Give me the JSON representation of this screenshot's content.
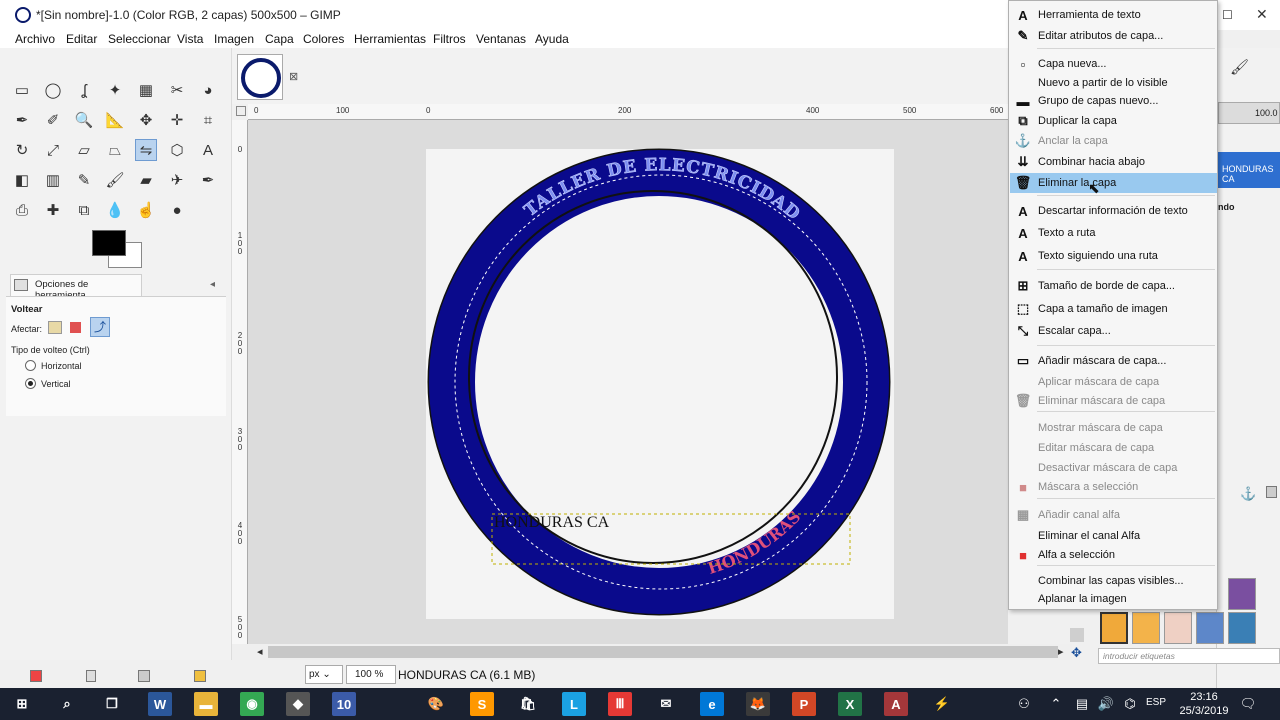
{
  "window": {
    "title": "*[Sin nombre]-1.0 (Color RGB, 2 capas) 500x500 – GIMP",
    "minimize": "–",
    "maximize": "☐",
    "close": "✕"
  },
  "menubar": [
    "Archivo",
    "Editar",
    "Seleccionar",
    "Vista",
    "Imagen",
    "Capa",
    "Colores",
    "Herramientas",
    "Filtros",
    "Ventanas",
    "Ayuda"
  ],
  "tool_options": {
    "tab_label": "Opciones de herramienta",
    "tool_name": "Voltear",
    "affect_label": "Afectar:",
    "flip_type_label": "Tipo de volteo  (Ctrl)",
    "horizontal": "Horizontal",
    "vertical": "Vertical",
    "selected": "Vertical"
  },
  "rulers": {
    "horizontal": [
      "0",
      "100",
      "0",
      "200",
      "400",
      "500",
      "600"
    ],
    "vertical": [
      "0",
      "100",
      "200",
      "300",
      "400",
      "500"
    ]
  },
  "canvas": {
    "top_text": "TALLER DE ELECTRICIDAD",
    "bottom_text": "HONDURAS CA",
    "plain_text": "HONDURAS CA",
    "ring_color": "#0a0a8c",
    "top_text_color": "#7d8ff0",
    "bottom_text_color": "#e0507a"
  },
  "status": {
    "unit": "px",
    "zoom": "100 %",
    "text": "HONDURAS CA (6.1 MB)"
  },
  "dock": {
    "opacity_value": "100.0",
    "layer_selected": "HONDURAS CA",
    "tag_placeholder": "introducir etiquetas",
    "partial_label": "ndo"
  },
  "context_menu": {
    "items": [
      {
        "label": "Herramienta de texto",
        "icon": "text-A-icon",
        "glyph": "A",
        "disabled": false
      },
      {
        "label": "Editar atributos de capa...",
        "icon": "edit-attributes-icon",
        "glyph": "✎",
        "disabled": false
      },
      {
        "label": "Capa nueva...",
        "icon": "new-layer-icon",
        "glyph": "▫",
        "disabled": false
      },
      {
        "label": "Nuevo a partir de lo visible",
        "icon": "",
        "glyph": "",
        "disabled": false
      },
      {
        "label": "Grupo de capas nuevo...",
        "icon": "folder-icon",
        "glyph": "▬",
        "disabled": false
      },
      {
        "label": "Duplicar la capa",
        "icon": "duplicate-icon",
        "glyph": "⧉",
        "disabled": false
      },
      {
        "label": "Anclar la capa",
        "icon": "anchor-icon",
        "glyph": "⚓",
        "disabled": true
      },
      {
        "label": "Combinar hacia abajo",
        "icon": "merge-down-icon",
        "glyph": "⇊",
        "disabled": false
      },
      {
        "label": "Eliminar la capa",
        "icon": "trash-icon",
        "glyph": "🗑",
        "disabled": false,
        "highlighted": true
      },
      {
        "label": "Descartar información de texto",
        "icon": "text-A-icon",
        "glyph": "A",
        "disabled": false
      },
      {
        "label": "Texto a ruta",
        "icon": "text-A-icon",
        "glyph": "A",
        "disabled": false
      },
      {
        "label": "Texto siguiendo una ruta",
        "icon": "text-A-icon",
        "glyph": "A",
        "disabled": false
      },
      {
        "label": "Tamaño de borde de capa...",
        "icon": "layer-boundary-icon",
        "glyph": "⊞",
        "disabled": false
      },
      {
        "label": "Capa a tamaño de imagen",
        "icon": "layer-to-image-icon",
        "glyph": "⬚",
        "disabled": false
      },
      {
        "label": "Escalar capa...",
        "icon": "scale-layer-icon",
        "glyph": "⤡",
        "disabled": false
      },
      {
        "label": "Añadir máscara de capa...",
        "icon": "add-mask-icon",
        "glyph": "▭",
        "disabled": false
      },
      {
        "label": "Aplicar máscara de capa",
        "icon": "",
        "glyph": "",
        "disabled": true
      },
      {
        "label": "Eliminar máscara de capa",
        "icon": "trash-icon",
        "glyph": "🗑",
        "disabled": true
      },
      {
        "label": "Mostrar máscara de capa",
        "icon": "",
        "glyph": "",
        "disabled": true
      },
      {
        "label": "Editar máscara de capa",
        "icon": "",
        "glyph": "",
        "disabled": true
      },
      {
        "label": "Desactivar máscara de capa",
        "icon": "",
        "glyph": "",
        "disabled": true
      },
      {
        "label": "Máscara a selección",
        "icon": "mask-to-selection-icon",
        "glyph": "■",
        "disabled": true
      },
      {
        "label": "Añadir canal alfa",
        "icon": "alpha-icon",
        "glyph": "▦",
        "disabled": true
      },
      {
        "label": "Eliminar el canal Alfa",
        "icon": "",
        "glyph": "",
        "disabled": false
      },
      {
        "label": "Alfa a selección",
        "icon": "alpha-to-selection-icon",
        "glyph": "■",
        "disabled": false
      },
      {
        "label": "Combinar las capas visibles...",
        "icon": "",
        "glyph": "",
        "disabled": false
      },
      {
        "label": "Aplanar la imagen",
        "icon": "",
        "glyph": "",
        "disabled": false
      }
    ]
  },
  "taskbar": {
    "time": "23:16",
    "date": "25/3/2019",
    "language": "ESP"
  }
}
